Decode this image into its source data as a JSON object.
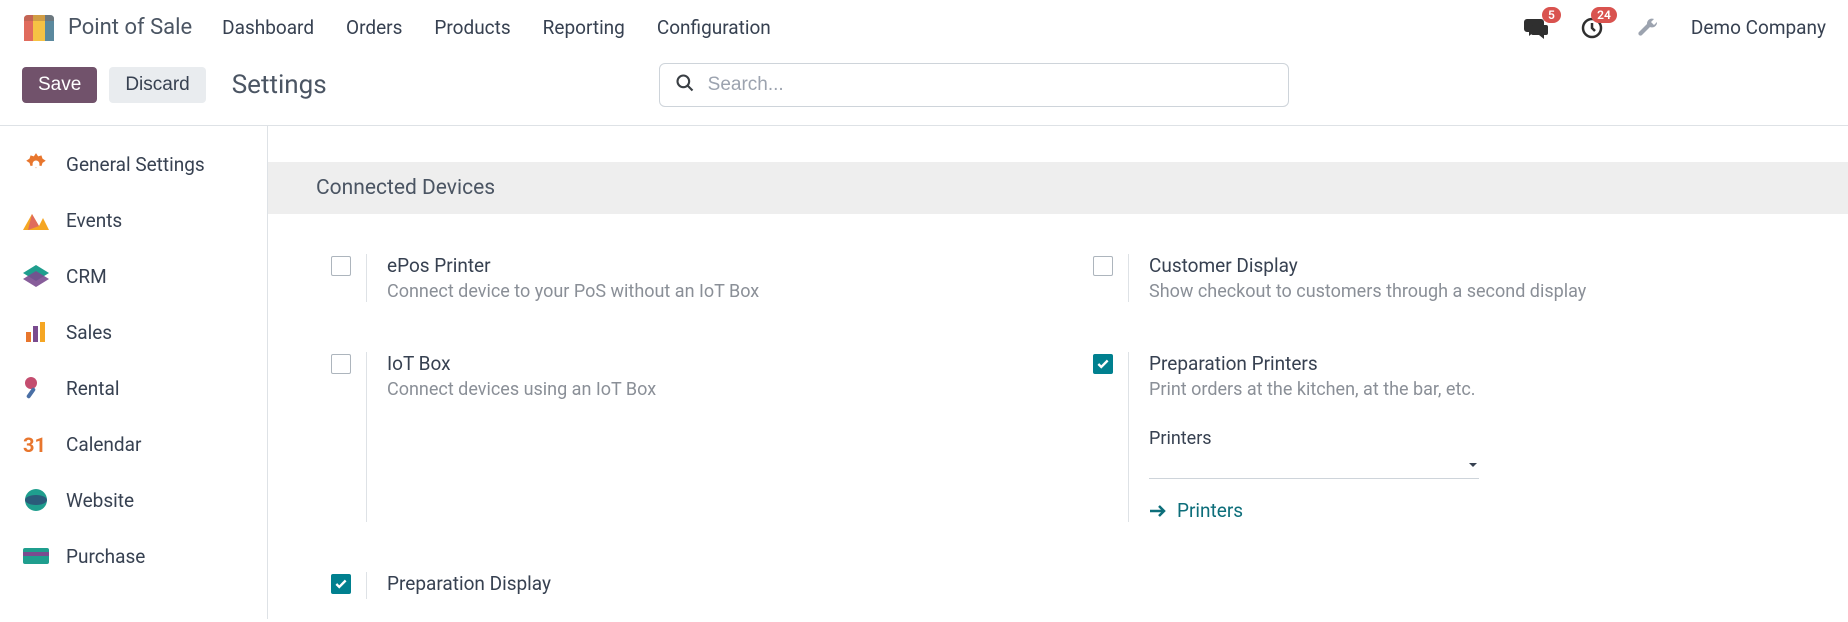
{
  "app": {
    "title": "Point of Sale"
  },
  "topnav": {
    "dashboard": "Dashboard",
    "orders": "Orders",
    "products": "Products",
    "reporting": "Reporting",
    "configuration": "Configuration"
  },
  "topbar": {
    "messages_badge": "5",
    "activities_badge": "24",
    "company": "Demo Company"
  },
  "actions": {
    "save": "Save",
    "discard": "Discard",
    "page_title": "Settings"
  },
  "search": {
    "placeholder": "Search..."
  },
  "sidebar": {
    "general": "General Settings",
    "events": "Events",
    "crm": "CRM",
    "sales": "Sales",
    "rental": "Rental",
    "calendar": "Calendar",
    "website": "Website",
    "purchase": "Purchase"
  },
  "section": {
    "connected_devices": "Connected Devices"
  },
  "settings": {
    "epos": {
      "title": "ePos Printer",
      "desc": "Connect device to your PoS without an IoT Box",
      "checked": false
    },
    "customer_display": {
      "title": "Customer Display",
      "desc": "Show checkout to customers through a second display",
      "checked": false
    },
    "iot_box": {
      "title": "IoT Box",
      "desc": "Connect devices using an IoT Box",
      "checked": false
    },
    "prep_printers": {
      "title": "Preparation Printers",
      "desc": "Print orders at the kitchen, at the bar, etc.",
      "checked": true,
      "field_label": "Printers",
      "link": "Printers"
    },
    "prep_display": {
      "title": "Preparation Display",
      "checked": true
    }
  }
}
